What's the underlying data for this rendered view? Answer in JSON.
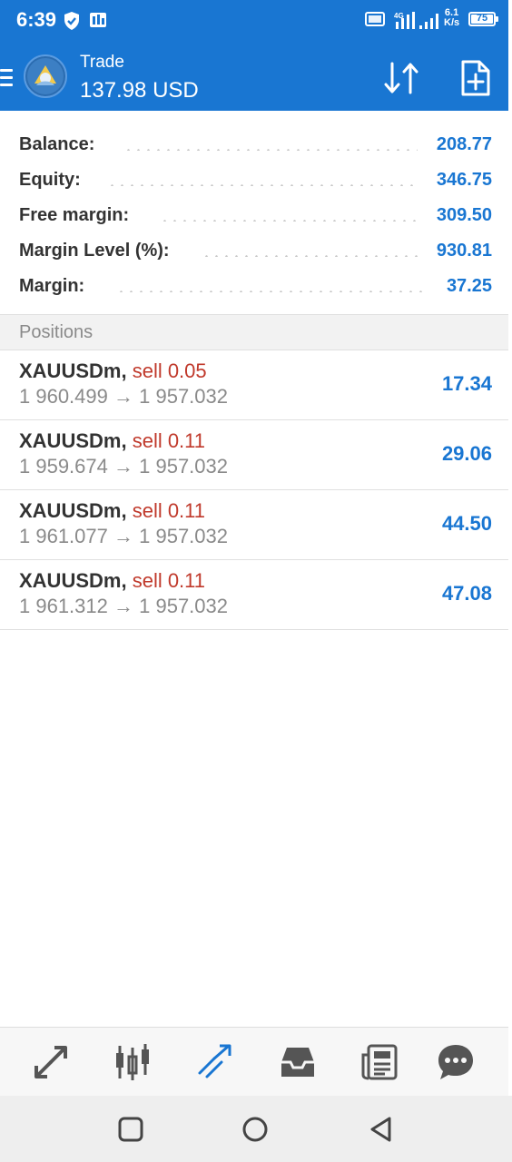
{
  "status_bar": {
    "time": "6:39",
    "network_type": "4G",
    "net_speed_value": "6.1",
    "net_speed_unit": "K/s",
    "battery": "75"
  },
  "header": {
    "section": "Trade",
    "balance_display": "137.98 USD"
  },
  "account": [
    {
      "label": "Balance:",
      "value": "208.77"
    },
    {
      "label": "Equity:",
      "value": "346.75"
    },
    {
      "label": "Free margin:",
      "value": "309.50"
    },
    {
      "label": "Margin Level (%):",
      "value": "930.81"
    },
    {
      "label": "Margin:",
      "value": "37.25"
    }
  ],
  "positions_title": "Positions",
  "positions": [
    {
      "symbol": "XAUUSDm,",
      "side": "sell 0.05",
      "open": "1 960.499",
      "arrow": "→",
      "current": "1 957.032",
      "profit": "17.34"
    },
    {
      "symbol": "XAUUSDm,",
      "side": "sell 0.11",
      "open": "1 959.674",
      "arrow": "→",
      "current": "1 957.032",
      "profit": "29.06"
    },
    {
      "symbol": "XAUUSDm,",
      "side": "sell 0.11",
      "open": "1 961.077",
      "arrow": "→",
      "current": "1 957.032",
      "profit": "44.50"
    },
    {
      "symbol": "XAUUSDm,",
      "side": "sell 0.11",
      "open": "1 961.312",
      "arrow": "→",
      "current": "1 957.032",
      "profit": "47.08"
    }
  ],
  "bottom_nav": [
    "quotes-icon",
    "chart-icon",
    "trade-icon",
    "history-icon",
    "news-icon",
    "messages-icon"
  ],
  "colors": {
    "primary": "#1976d2",
    "sell": "#c0392b",
    "muted": "#8a8a8a",
    "active_tab": "#1976d2",
    "inactive_tab": "#555555"
  }
}
